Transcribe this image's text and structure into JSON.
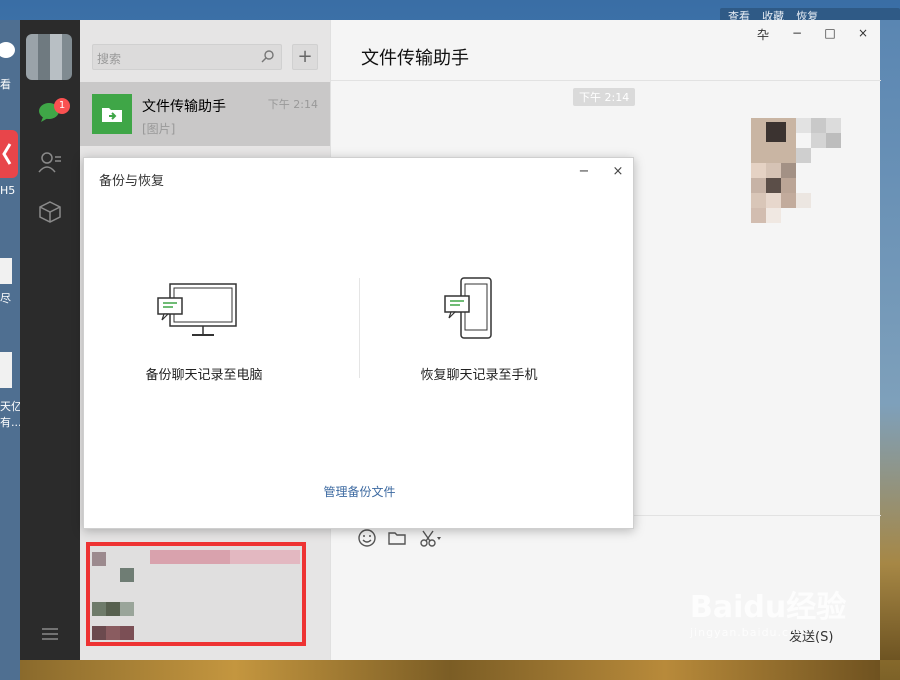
{
  "desktop": {
    "top_right_labels": [
      "查看",
      "收藏",
      "恢复"
    ],
    "left_labels": [
      "看",
      "H5",
      "尽",
      "天亿",
      "有..."
    ]
  },
  "app": {
    "badge_count": "1",
    "search": {
      "placeholder": "搜索"
    },
    "add_button": "+",
    "conversation": {
      "name": "文件传输助手",
      "time": "下午 2:14",
      "preview": "[图片]"
    }
  },
  "chat": {
    "title": "文件传输助手",
    "timestamp": "下午 2:14",
    "window_controls": {
      "pin": "卆",
      "minimize": "−",
      "maximize": "□",
      "close": "×"
    },
    "send_label": "发送(S)"
  },
  "dialog": {
    "title": "备份与恢复",
    "minimize": "−",
    "close": "×",
    "option_backup": "备份聊天记录至电脑",
    "option_restore": "恢复聊天记录至手机",
    "manage_link": "管理备份文件"
  },
  "watermark": {
    "brand": "Baidu经验",
    "url": "jingyan.baidu.com"
  },
  "colors": {
    "accent_green": "#3fa647",
    "badge_red": "#fa5151",
    "link_blue": "#3d6aa1",
    "highlight_red": "#e33333"
  }
}
